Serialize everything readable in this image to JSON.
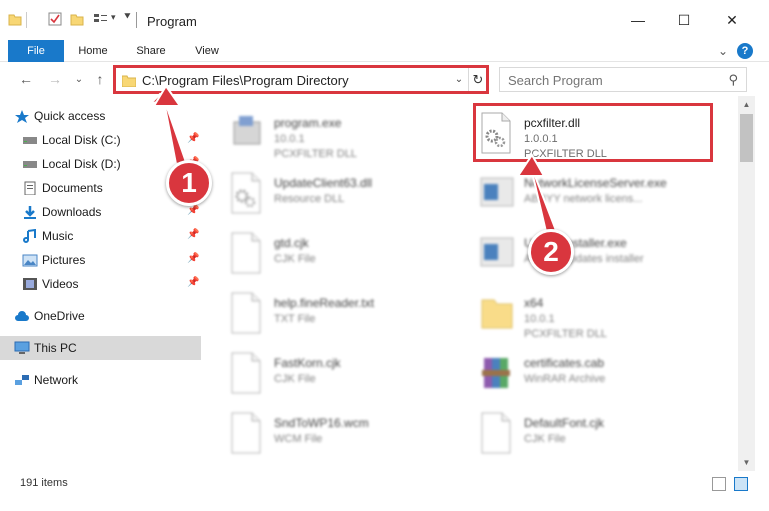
{
  "window": {
    "title": "Program",
    "minimize_glyph": "—",
    "maximize_glyph": "☐",
    "close_glyph": "✕"
  },
  "ribbon": {
    "tabs": [
      "File",
      "Home",
      "Share",
      "View"
    ],
    "collapse_glyph": "⌄",
    "help_glyph": "?"
  },
  "nav": {
    "back_glyph": "←",
    "forward_glyph": "→",
    "recent_glyph": "⌄",
    "up_glyph": "↑",
    "address": "C:\\Program Files\\Program Directory",
    "address_dd_glyph": "⌄",
    "refresh_glyph": "↻",
    "search_placeholder": "Search Program",
    "search_glyph": "⚲"
  },
  "sidebar": {
    "items": [
      {
        "label": "Quick access",
        "icon": "star-icon",
        "pinned": false
      },
      {
        "label": "Local Disk (C:)",
        "icon": "drive-icon",
        "pinned": true
      },
      {
        "label": "Local Disk (D:)",
        "icon": "drive-icon",
        "pinned": true
      },
      {
        "label": "Documents",
        "icon": "documents-icon",
        "pinned": true
      },
      {
        "label": "Downloads",
        "icon": "download-icon",
        "pinned": true
      },
      {
        "label": "Music",
        "icon": "music-icon",
        "pinned": true
      },
      {
        "label": "Pictures",
        "icon": "pictures-icon",
        "pinned": true
      },
      {
        "label": "Videos",
        "icon": "videos-icon",
        "pinned": true
      },
      {
        "label": "OneDrive",
        "icon": "cloud-icon",
        "pinned": false
      },
      {
        "label": "This PC",
        "icon": "computer-icon",
        "pinned": false,
        "selected": true
      },
      {
        "label": "Network",
        "icon": "network-icon",
        "pinned": false
      }
    ],
    "pin_glyph": "📌"
  },
  "files": [
    {
      "name": "program.exe",
      "line2": "10.0.1",
      "line3": "PCXFILTER DLL",
      "icon": "exe-icon",
      "blurred": true
    },
    {
      "name": "pcxfilter.dll",
      "line2": "1.0.0.1",
      "line3": "PCXFILTER DLL",
      "icon": "dll-gear-icon",
      "blurred": false,
      "highlighted": true
    },
    {
      "name": "UpdateClient63.dll",
      "line2": "Resource DLL",
      "line3": "",
      "icon": "dll-gear-icon",
      "blurred": true
    },
    {
      "name": "NetworkLicenseServer.exe",
      "line2": "ABBYY network licens...",
      "line3": "",
      "icon": "app-window-icon",
      "blurred": true
    },
    {
      "name": "gtd.cjk",
      "line2": "CJK File",
      "line3": "",
      "icon": "file-icon",
      "blurred": true
    },
    {
      "name": "UpdateInstaller.exe",
      "line2": "ABBYY updates installer",
      "line3": "",
      "icon": "app-window-icon",
      "blurred": true
    },
    {
      "name": "help.fineReader.txt",
      "line2": "TXT File",
      "line3": "",
      "icon": "file-icon",
      "blurred": true
    },
    {
      "name": "x64",
      "line2": "10.0.1",
      "line3": "PCXFILTER DLL",
      "icon": "folder-icon",
      "blurred": true
    },
    {
      "name": "FastKorn.cjk",
      "line2": "CJK File",
      "line3": "",
      "icon": "file-icon",
      "blurred": true
    },
    {
      "name": "certificates.cab",
      "line2": "WinRAR Archive",
      "line3": "",
      "icon": "archive-icon",
      "blurred": true
    },
    {
      "name": "SndToWP16.wcm",
      "line2": "WCM File",
      "line3": "",
      "icon": "file-icon",
      "blurred": true
    },
    {
      "name": "DefaultFont.cjk",
      "line2": "CJK File",
      "line3": "",
      "icon": "file-icon",
      "blurred": true
    }
  ],
  "status": {
    "item_count": "191 items"
  },
  "annotations": {
    "badge_1": "1",
    "badge_2": "2",
    "color": "#d9363e"
  },
  "colors": {
    "accent": "#1979ca",
    "selected_bg": "#d9d9d9",
    "annotation_red": "#d9363e"
  }
}
